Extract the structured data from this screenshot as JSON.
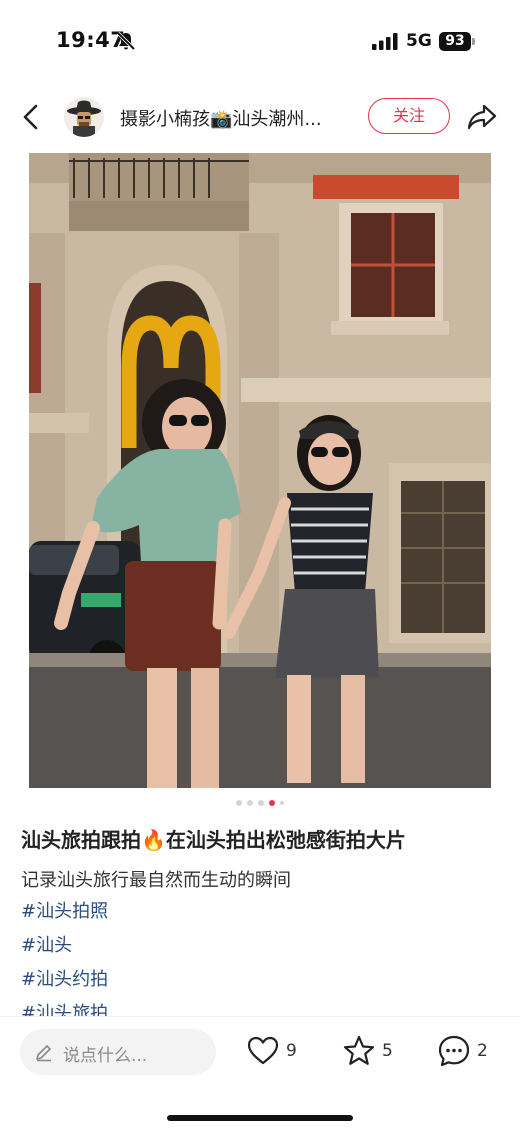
{
  "status_bar": {
    "time": "19:47",
    "network": "5G",
    "battery": "93"
  },
  "header": {
    "author_name": "摄影小楠孩📸汕头潮州...",
    "follow_label": "关注"
  },
  "post": {
    "pager": {
      "total": 5,
      "active_index": 3
    },
    "title_prefix": "汕头旅拍跟拍",
    "title_emoji": "🔥",
    "title_suffix": "在汕头拍出松弛感街拍大片",
    "description": "记录汕头旅行最自然而生动的瞬间",
    "tags": [
      "#汕头拍照",
      "#汕头",
      "#汕头约拍",
      "#汕头旅拍"
    ]
  },
  "bottom_bar": {
    "comment_placeholder": "说点什么...",
    "likes": "9",
    "collects": "5",
    "comments": "2"
  },
  "colors": {
    "accent": "#e8344e",
    "tag": "#2a4d7d"
  }
}
